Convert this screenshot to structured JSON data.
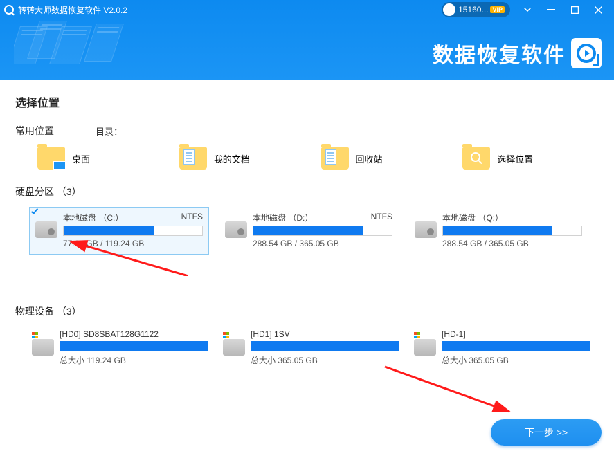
{
  "titlebar": {
    "app_title": "转转大师数据恢复软件 V2.0.2",
    "user_id": "15160...",
    "vip_label": "VIP"
  },
  "brand": {
    "text": "数据恢复软件"
  },
  "section": {
    "select_location": "选择位置",
    "common_locations": "常用位置",
    "directory_label": "目录：",
    "disk_partitions": "硬盘分区 （3）",
    "physical_devices": "物理设备 （3）"
  },
  "common": {
    "desktop": "桌面",
    "documents": "我的文档",
    "recycle_bin": "回收站",
    "choose_location": "选择位置"
  },
  "partitions": [
    {
      "name": "本地磁盘 （C:）",
      "fs": "NTFS",
      "used": "77.13 GB",
      "total": "119.24 GB",
      "fill": 65,
      "selected": true
    },
    {
      "name": "本地磁盘 （D:）",
      "fs": "NTFS",
      "used": "288.54 GB",
      "total": "365.05 GB",
      "fill": 79,
      "selected": false
    },
    {
      "name": "本地磁盘 （Q:）",
      "fs": "",
      "used": "288.54 GB",
      "total": "365.05 GB",
      "fill": 79,
      "selected": false
    }
  ],
  "devices": [
    {
      "name": "[HD0] SD8SBAT128G1122",
      "size_label": "总大小 119.24 GB"
    },
    {
      "name": "[HD1] 1SV",
      "size_label": "总大小 365.05 GB"
    },
    {
      "name": "[HD-1]",
      "size_label": "总大小 365.05 GB"
    }
  ],
  "next_button": "下一步 >>"
}
